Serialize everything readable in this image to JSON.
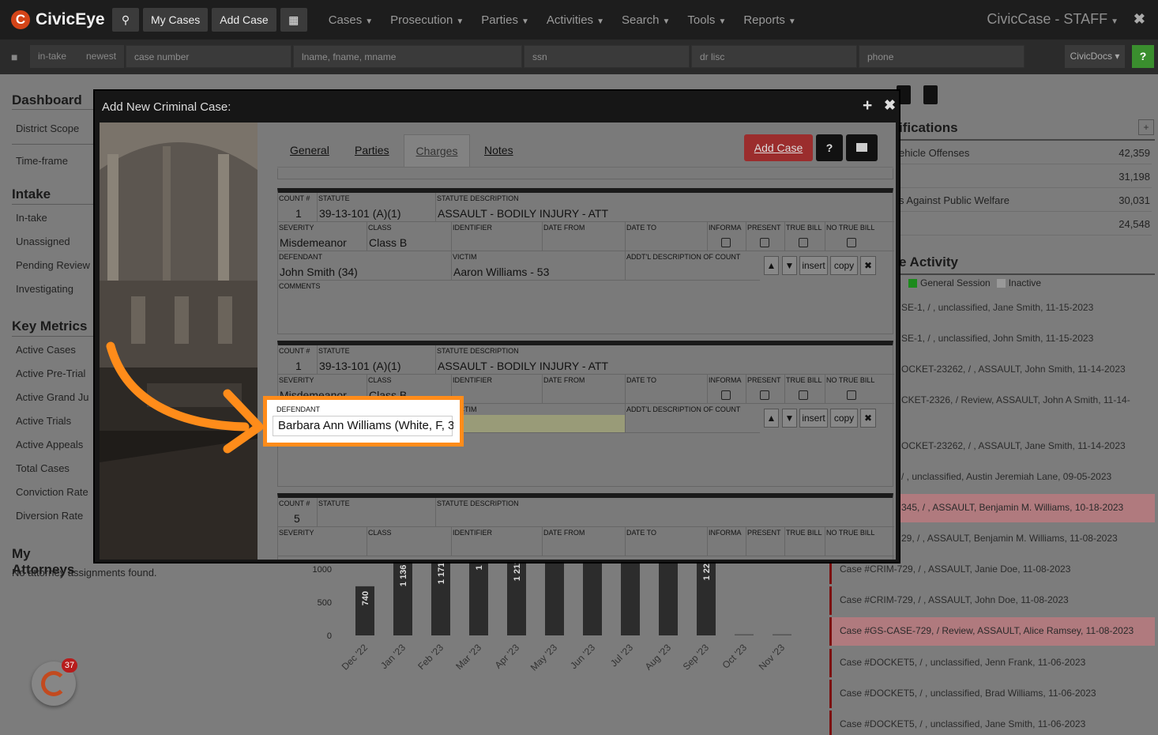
{
  "app": {
    "name": "CivicEye",
    "title": "CivicCase - STAFF"
  },
  "topbar": {
    "buttons": [
      "My Cases",
      "Add Case"
    ],
    "menus": [
      "Cases",
      "Prosecution",
      "Parties",
      "Activities",
      "Search",
      "Tools",
      "Reports"
    ]
  },
  "searchbar": {
    "filters": [
      "in-take",
      "newest"
    ],
    "fields": [
      "case number",
      "lname, fname, mname",
      "ssn",
      "dr lisc",
      "phone"
    ],
    "docs": "CivicDocs",
    "help": "?"
  },
  "leftnav": {
    "dashboard": {
      "title": "Dashboard",
      "items": [
        "District Scope",
        "Time-frame"
      ]
    },
    "intake": {
      "title": "Intake",
      "items": [
        "In-take",
        "Unassigned",
        "Pending Review",
        "Investigating"
      ]
    },
    "metrics": {
      "title": "Key Metrics",
      "items": [
        "Active Cases",
        "Active Pre-Trial",
        "Active Grand Ju",
        "Active Trials",
        "Active Appeals",
        "Total Cases",
        "Conviction Rate",
        "Diversion Rate"
      ]
    },
    "attorneys": {
      "title": "My Attorneys",
      "note": "No attorney assignments found."
    }
  },
  "right": {
    "classifications": {
      "title": "ifications",
      "rows": [
        {
          "label": "ehicle Offenses",
          "value": "42,359"
        },
        {
          "label": "",
          "value": "31,198"
        },
        {
          "label": "s Against Public Welfare",
          "value": "30,031"
        },
        {
          "label": "",
          "value": "24,548"
        }
      ]
    },
    "activity": {
      "title": "e Activity",
      "legend": [
        "General Session",
        "Inactive"
      ],
      "items": [
        "SE-1, / , unclassified, Jane Smith, 11-15-2023",
        "SE-1, / , unclassified, John Smith, 11-15-2023",
        "OCKET-23262, / , ASSAULT, John Smith, 11-14-2023",
        "CKET-2326, / Review, ASSAULT, John A Smith, 11-14-",
        "OCKET-23262, / , ASSAULT, Jane Smith, 11-14-2023",
        "/ , unclassified, Austin Jeremiah Lane, 09-05-2023",
        "345, / , ASSAULT, Benjamin M. Williams, 10-18-2023",
        "29, / , ASSAULT, Benjamin M. Williams, 11-08-2023",
        "Case #CRIM-729, / , ASSAULT, Janie Doe, 11-08-2023",
        "Case #CRIM-729, / , ASSAULT, John Doe, 11-08-2023",
        "Case #GS-CASE-729, / Review, ASSAULT, Alice Ramsey, 11-08-2023",
        "Case #DOCKET5, / , unclassified, Jenn Frank, 11-06-2023",
        "Case #DOCKET5, / , unclassified, Brad Williams, 11-06-2023",
        "Case #DOCKET5, / , unclassified, Jane Smith, 11-06-2023"
      ]
    }
  },
  "chart_data": {
    "type": "bar",
    "categories": [
      "Dec '22",
      "Jan '23",
      "Feb '23",
      "Mar '23",
      "Apr '23",
      "May '23",
      "Jun '23",
      "Jul '23",
      "Aug '23",
      "Sep '23",
      "Oct '23",
      "Nov '23"
    ],
    "values": [
      740,
      1136,
      1171,
      1200,
      1211,
      1250,
      1250,
      1250,
      1250,
      1228,
      10,
      5
    ],
    "data_labels": [
      "740",
      "1 136",
      "1 171",
      "1 .",
      "1 211",
      "",
      "1",
      "1",
      "",
      "1 228",
      "",
      ""
    ],
    "ylim": [
      0,
      1000
    ],
    "yticks": [
      "0",
      "500",
      "1000"
    ]
  },
  "modal": {
    "title": "Add New Criminal Case:",
    "tabs": [
      "General",
      "Parties",
      "Charges",
      "Notes"
    ],
    "add_button": "Add Case",
    "help_button": "?",
    "labels": {
      "count": "COUNT #",
      "statute": "STATUTE",
      "statute_desc": "STATUTE DESCRIPTION",
      "severity": "SEVERITY",
      "class": "CLASS",
      "identifier": "IDENTIFIER",
      "date_from": "DATE FROM",
      "date_to": "DATE TO",
      "informa": "INFORMA",
      "present": "PRESENT",
      "true_bill": "TRUE BILL",
      "no_true_bill": "NO TRUE BILL",
      "defendant": "DEFENDANT",
      "victim": "VICTIM",
      "addtl": "ADDT'L DESCRIPTION OF COUNT",
      "comments": "COMMENTS"
    },
    "buttons": {
      "insert": "insert",
      "copy": "copy"
    },
    "counts": [
      {
        "count": "1",
        "statute": "39-13-101 (A)(1)",
        "desc": "ASSAULT -  BODILY INJURY - ATT",
        "severity": "Misdemeanor",
        "class": "Class B",
        "defendant": "John Smith (34)",
        "victim": "Aaron Williams - 53"
      },
      {
        "count": "1",
        "statute": "39-13-101 (A)(1)",
        "desc": "ASSAULT -  BODILY INJURY - ATT",
        "severity": "Misdemeanor",
        "class": "Class B",
        "defendant": "Barbara Ann Williams (White, F, 3",
        "victim": ""
      },
      {
        "count": "5",
        "statute": "",
        "desc": "",
        "severity": "",
        "class": "",
        "defendant": "",
        "victim": ""
      }
    ]
  }
}
